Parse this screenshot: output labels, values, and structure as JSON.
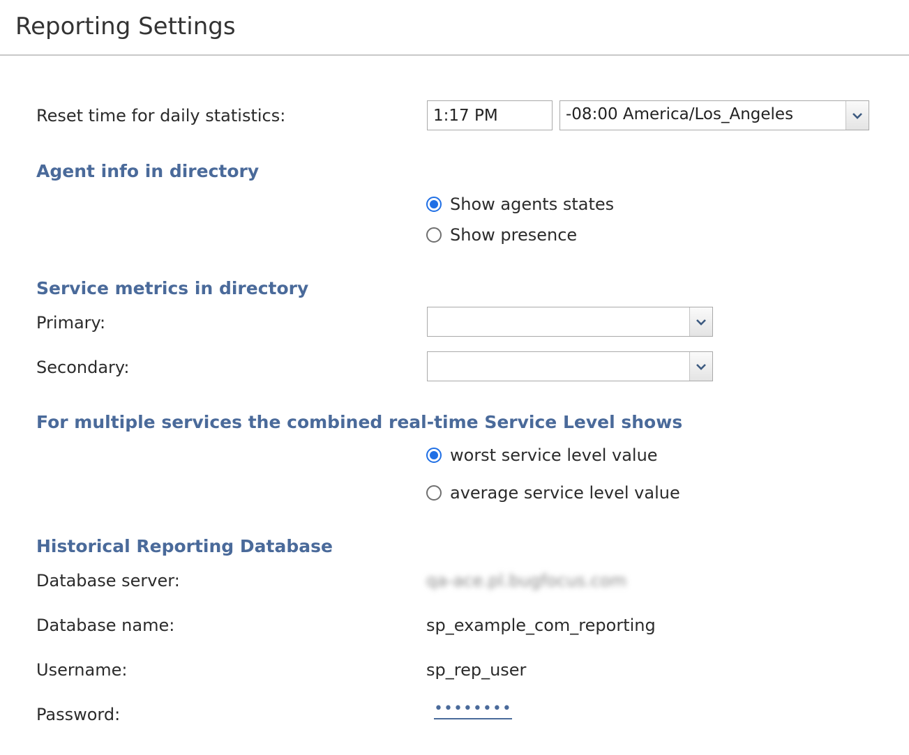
{
  "header": {
    "title": "Reporting Settings"
  },
  "reset_time": {
    "label": "Reset time for daily statistics:",
    "time_value": "1:17 PM",
    "timezone_value": "-08:00 America/Los_Angeles"
  },
  "agent_info": {
    "heading": "Agent info in directory",
    "options": [
      {
        "label": "Show agents states",
        "checked": true
      },
      {
        "label": "Show presence",
        "checked": false
      }
    ]
  },
  "service_metrics": {
    "heading": "Service metrics in directory",
    "primary_label": "Primary:",
    "primary_value": "",
    "secondary_label": "Secondary:",
    "secondary_value": ""
  },
  "service_level": {
    "heading": "For multiple services the combined real-time Service Level shows",
    "options": [
      {
        "label": "worst service level value",
        "checked": true
      },
      {
        "label": "average service level value",
        "checked": false
      }
    ]
  },
  "database": {
    "heading": "Historical Reporting Database",
    "server_label": "Database server:",
    "server_value": "qa-ace.pl.bugfocus.com",
    "name_label": "Database name:",
    "name_value": "sp_example_com_reporting",
    "username_label": "Username:",
    "username_value": "sp_rep_user",
    "password_label": "Password:",
    "password_value": "••••••••"
  },
  "icons": {
    "dropdown_arrow": "chevron-down-icon",
    "radio_checked": "radio-checked-icon",
    "radio_unchecked": "radio-unchecked-icon"
  },
  "colors": {
    "section_heading": "#4a6a9a",
    "radio_accent": "#1f6fe5",
    "header_rule": "#c8c8c8"
  }
}
